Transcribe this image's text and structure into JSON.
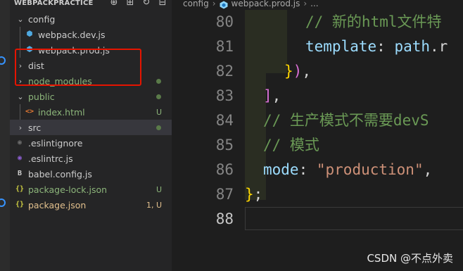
{
  "explorer": {
    "title": "WEBPACKPRACTICE",
    "actions": [
      {
        "name": "new-file-icon",
        "glyph": "⊕"
      },
      {
        "name": "new-folder-icon",
        "glyph": "⊞"
      },
      {
        "name": "refresh-icon",
        "glyph": "↻"
      },
      {
        "name": "collapse-all-icon",
        "glyph": "⊟"
      }
    ],
    "items": [
      {
        "label": "config",
        "chevron": "⌄",
        "icon": "",
        "color": "#cccccc",
        "badge": "",
        "dot": false
      },
      {
        "label": "webpack.dev.js",
        "chevron": "",
        "icon": "webpack-icon",
        "color": "#cccccc",
        "badge": "",
        "dot": false
      },
      {
        "label": "webpack.prod.js",
        "chevron": "",
        "icon": "webpack-icon",
        "color": "#cccccc",
        "badge": "",
        "dot": false
      },
      {
        "label": "dist",
        "chevron": "›",
        "icon": "",
        "color": "#cccccc",
        "badge": "",
        "dot": false
      },
      {
        "label": "node_modules",
        "chevron": "›",
        "icon": "",
        "color": "#8cb57a",
        "badge": "",
        "dot": true
      },
      {
        "label": "public",
        "chevron": "⌄",
        "icon": "",
        "color": "#8cb57a",
        "badge": "",
        "dot": true
      },
      {
        "label": "index.html",
        "chevron": "",
        "icon": "html-icon",
        "color": "#8cb57a",
        "badge": "U",
        "dot": false
      },
      {
        "label": "src",
        "chevron": "›",
        "icon": "",
        "color": "#cccccc",
        "badge": "",
        "dot": true
      },
      {
        "label": ".eslintignore",
        "chevron": "",
        "icon": "eslint-ignore-icon",
        "color": "#cccccc",
        "badge": "",
        "dot": false
      },
      {
        "label": ".eslintrc.js",
        "chevron": "",
        "icon": "eslint-icon",
        "color": "#cccccc",
        "badge": "",
        "dot": false
      },
      {
        "label": "babel.config.js",
        "chevron": "",
        "icon": "js-icon",
        "color": "#cccccc",
        "badge": "",
        "dot": false
      },
      {
        "label": "package-lock.json",
        "chevron": "",
        "icon": "json-icon",
        "color": "#8cb57a",
        "badge": "U",
        "dot": false
      },
      {
        "label": "package.json",
        "chevron": "",
        "icon": "json-icon",
        "color": "#e2c08d",
        "badge": "1, U",
        "dot": false
      }
    ]
  },
  "breadcrumbs": {
    "folder": "config",
    "file": "webpack.prod.js",
    "more": "..."
  },
  "editor": {
    "lines": [
      {
        "num": "80",
        "tokens": [
          {
            "t": "// 新的html文件特",
            "c": "c-comment"
          }
        ]
      },
      {
        "num": "81",
        "tokens": [
          {
            "t": "template",
            "c": "c-prop"
          },
          {
            "t": ": ",
            "c": "c-punc"
          },
          {
            "t": "path",
            "c": "c-prop"
          },
          {
            "t": ".r",
            "c": "c-punc"
          }
        ]
      },
      {
        "num": "82",
        "tokens": [
          {
            "t": "}",
            "c": "c-brace2"
          },
          {
            "t": ")",
            "c": "c-brace1"
          },
          {
            "t": ",",
            "c": "c-punc"
          }
        ]
      },
      {
        "num": "83",
        "tokens": [
          {
            "t": "]",
            "c": "c-brace1"
          },
          {
            "t": ",",
            "c": "c-punc"
          }
        ]
      },
      {
        "num": "84",
        "tokens": [
          {
            "t": "// 生产模式不需要devS",
            "c": "c-comment"
          }
        ]
      },
      {
        "num": "85",
        "tokens": [
          {
            "t": "// 模式",
            "c": "c-comment"
          }
        ]
      },
      {
        "num": "86",
        "tokens": [
          {
            "t": "mode",
            "c": "c-prop"
          },
          {
            "t": ": ",
            "c": "c-punc"
          },
          {
            "t": "\"production\"",
            "c": "c-str"
          },
          {
            "t": ",",
            "c": "c-punc"
          }
        ]
      },
      {
        "num": "87",
        "tokens": [
          {
            "t": "}",
            "c": "c-brace2"
          },
          {
            "t": ";",
            "c": "c-punc"
          }
        ]
      },
      {
        "num": "88",
        "tokens": []
      }
    ],
    "active_line": "88"
  },
  "watermark": "CSDN @不点外卖"
}
